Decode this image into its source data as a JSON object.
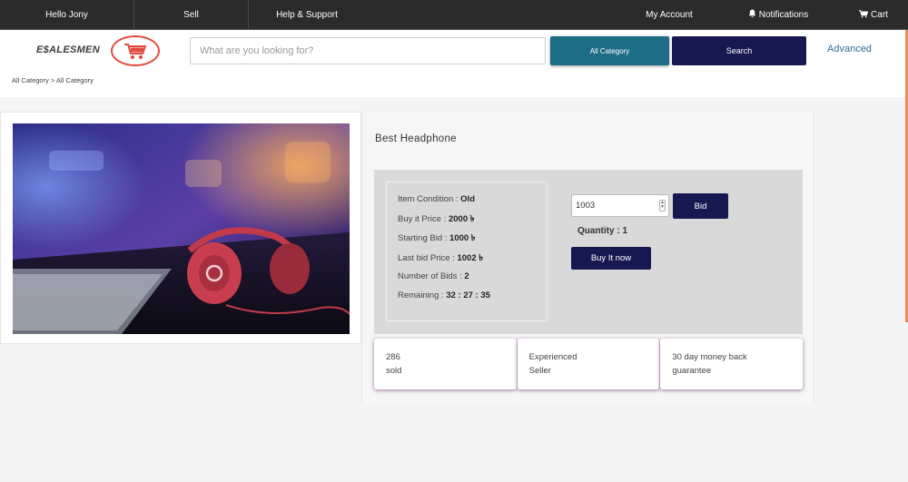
{
  "topnav": {
    "greeting": "Hello Jony",
    "sell": "Sell",
    "help": "Help & Support",
    "account": "My Account",
    "notifications": "Notifications",
    "cart": "Cart"
  },
  "header": {
    "logo": "E$ALESMEN",
    "search_placeholder": "What are you looking for?",
    "category_button": "All Category",
    "search_button": "Search",
    "advanced_link": "Advanced"
  },
  "breadcrumb": "All Category > All Category",
  "product": {
    "title": "Best Headphone",
    "info": [
      {
        "label": "Item Condition : ",
        "value": "Old"
      },
      {
        "label": "Buy it Price : ",
        "value": "2000 ৳"
      },
      {
        "label": "Starting Bid : ",
        "value": "1000 ৳"
      },
      {
        "label": "Last bid Price : ",
        "value": "1002 ৳"
      },
      {
        "label": "Number of Bids : ",
        "value": "2"
      },
      {
        "label": "Remaining : ",
        "value": "32 : 27 : 35"
      }
    ],
    "bid_value": "1003",
    "bid_button": "Bid",
    "quantity": "Quantity : 1",
    "buy_button": "Buy It now"
  },
  "features": [
    "286\nsold",
    "Experienced\nSeller",
    "30 day money back\nguarantee"
  ],
  "colors": {
    "navbar": "#2b2b2b",
    "primary_dark": "#161950",
    "category_teal": "#1d6d86",
    "accent_orange": "#ef8a62",
    "logo_red": "#e34b3e"
  }
}
